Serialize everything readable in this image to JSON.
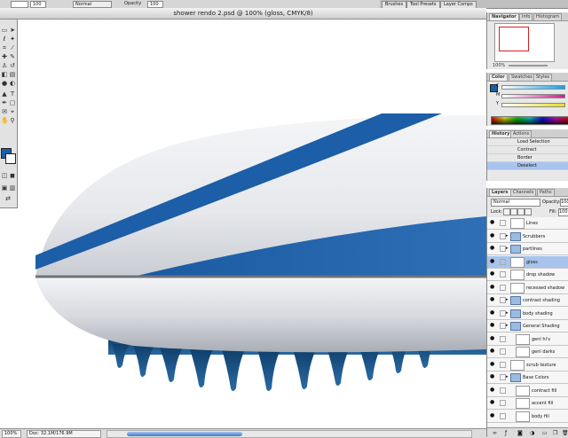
{
  "options_bar": {
    "field1": "",
    "opacity_value": "100",
    "mode_value": "Normal",
    "label_opacity": "Opacity",
    "label_flow": "Flow",
    "flow_value": "100"
  },
  "well_tabs": [
    "Brushes",
    "Tool Presets",
    "Layer Comps"
  ],
  "document": {
    "title": "shower rendo 2.psd @ 100% (gloss, CMYK/8)"
  },
  "status": {
    "zoom": "100%",
    "doc_size": "Doc: 32.1M/176.9M"
  },
  "navigator": {
    "tabs": [
      "Navigator",
      "Info",
      "Histogram"
    ],
    "zoom": "100%"
  },
  "color_panel": {
    "tabs": [
      "Color",
      "Swatches",
      "Styles"
    ],
    "channels": [
      "C",
      "M",
      "Y"
    ]
  },
  "history_panel": {
    "tabs": [
      "History",
      "Actions"
    ],
    "items": [
      "Load Selection",
      "Contract",
      "Border",
      "Deselect"
    ],
    "selected_index": 3
  },
  "layers_panel": {
    "tabs": [
      "Layers",
      "Channels",
      "Paths"
    ],
    "blend_mode": "Normal",
    "opacity_label": "Opacity:",
    "opacity_value": "100",
    "lock_label": "Lock:",
    "fill_label": "Fill:",
    "fill_value": "100",
    "layers": [
      {
        "name": "Lines",
        "kind": "layer"
      },
      {
        "name": "Scrubbers",
        "kind": "group"
      },
      {
        "name": "partlines",
        "kind": "group"
      },
      {
        "name": "gloss",
        "kind": "layer",
        "selected": true
      },
      {
        "name": "drop shadow",
        "kind": "layer"
      },
      {
        "name": "recessed shadow",
        "kind": "layer"
      },
      {
        "name": "contrast shading",
        "kind": "group"
      },
      {
        "name": "body shading",
        "kind": "group"
      },
      {
        "name": "General Shading",
        "kind": "group"
      },
      {
        "name": "genl hi's",
        "kind": "layer",
        "indent": true
      },
      {
        "name": "genl darks",
        "kind": "layer",
        "indent": true
      },
      {
        "name": "scrub texture",
        "kind": "layer"
      },
      {
        "name": "Base Colors",
        "kind": "group"
      },
      {
        "name": "contract fill",
        "kind": "layer",
        "indent": true
      },
      {
        "name": "accent fill",
        "kind": "layer",
        "indent": true
      },
      {
        "name": "body fill",
        "kind": "layer",
        "indent": true
      }
    ]
  },
  "colors": {
    "accent_blue": "#1c5ea7",
    "selection_blue": "#a8c4ec"
  }
}
